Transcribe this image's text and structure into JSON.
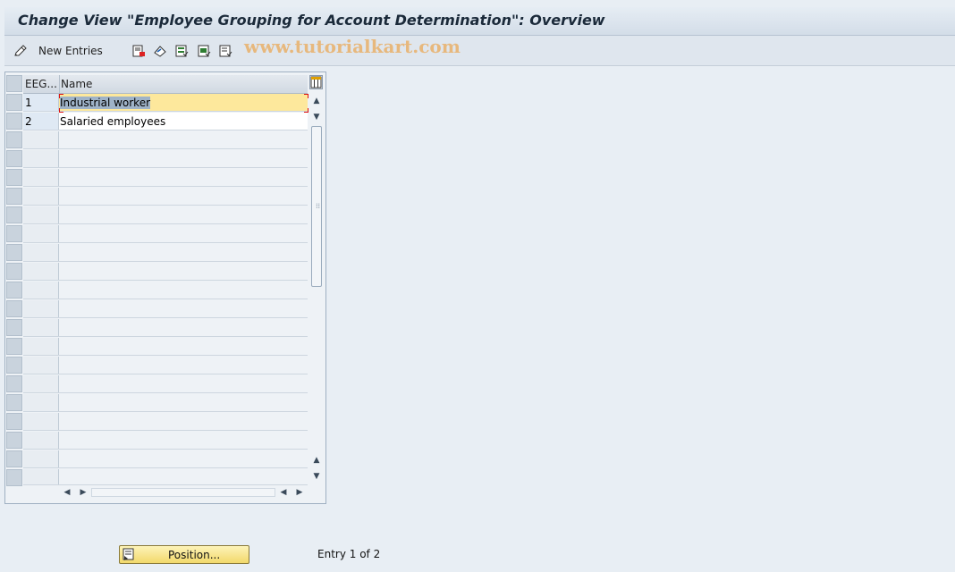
{
  "title": "Change View \"Employee Grouping for Account Determination\": Overview",
  "toolbar": {
    "new_entries_label": "New Entries",
    "watermark": "www.tutorialkart.com"
  },
  "table": {
    "columns": [
      "EEG...",
      "Name"
    ],
    "rows": [
      {
        "key": "1",
        "name": "Industrial worker"
      },
      {
        "key": "2",
        "name": "Salaried employees"
      }
    ]
  },
  "footer": {
    "position_label": "Position...",
    "entry_text": "Entry 1 of 2"
  },
  "colors": {
    "selected_row": "#fde89c",
    "button": "#f2d96b",
    "background": "#e8eef4"
  }
}
